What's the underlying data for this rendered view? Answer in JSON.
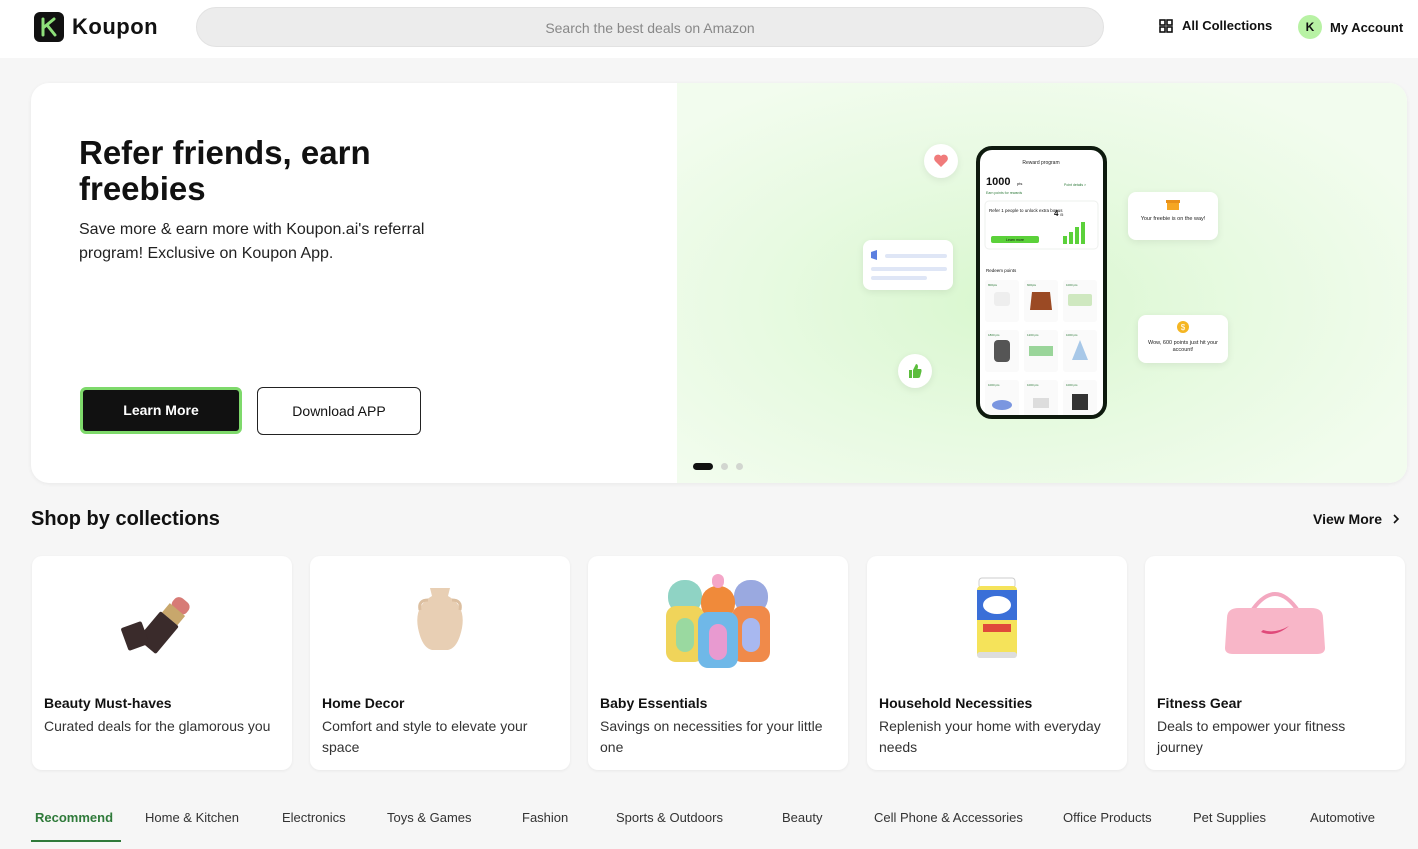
{
  "header": {
    "logo_text": "Koupon",
    "search_placeholder": "Search the best deals on Amazon",
    "all_collections": "All Collections",
    "avatar_initial": "K",
    "my_account": "My Account"
  },
  "hero": {
    "title": "Refer friends, earn freebies",
    "subtitle": "Save more & earn more with Koupon.ai's referral program! Exclusive on Koupon App.",
    "learn_more": "Learn More",
    "download_app": "Download APP",
    "carousel": {
      "count": 3,
      "active": 0
    },
    "phone": {
      "header": "Reward program",
      "points": "1000",
      "points_unit": "pts",
      "earn_points": "Earn points for rewards",
      "point_details": "Point details >",
      "refer_text": "Refer 1 people to unlock extra bonus",
      "refer_count": "4",
      "refer_total": "/5",
      "learn_more_small": "Learn more",
      "redeem": "Redeem points",
      "item_points": [
        "800pts",
        "600pts",
        "1000 pts",
        "1800 pts",
        "1200 pts",
        "1000 pts",
        "1000 pts",
        "1000 pts",
        "1000 pts"
      ]
    },
    "bubble_freebie": "Your freebie is on the way!",
    "bubble_points": "Wow, 600 points just hit your account!"
  },
  "collections": {
    "title": "Shop by collections",
    "view_more": "View More",
    "items": [
      {
        "title": "Beauty Must-haves",
        "desc": "Curated deals for the glamorous you"
      },
      {
        "title": "Home Decor",
        "desc": "Comfort and style to elevate your space"
      },
      {
        "title": "Baby Essentials",
        "desc": "Savings on necessities for your little one"
      },
      {
        "title": "Household Necessities",
        "desc": "Replenish your home with everyday needs"
      },
      {
        "title": "Fitness Gear",
        "desc": "Deals to empower your fitness journey"
      }
    ]
  },
  "tabs": [
    {
      "label": "Recommend",
      "active": true
    },
    {
      "label": "Home & Kitchen"
    },
    {
      "label": "Electronics"
    },
    {
      "label": "Toys & Games"
    },
    {
      "label": "Fashion"
    },
    {
      "label": "Sports & Outdoors"
    },
    {
      "label": "Beauty"
    },
    {
      "label": "Cell Phone & Accessories"
    },
    {
      "label": "Office Products"
    },
    {
      "label": "Pet Supplies"
    },
    {
      "label": "Automotive"
    }
  ],
  "colors": {
    "accent_green": "#2f7a3a",
    "light_green": "#7ed96b",
    "dark": "#111111"
  },
  "icons": [
    "koupon-logo-icon",
    "grid-icon",
    "chevron-right-icon",
    "heart-icon",
    "megaphone-icon",
    "thumbs-up-icon",
    "gift-icon",
    "coin-icon"
  ]
}
